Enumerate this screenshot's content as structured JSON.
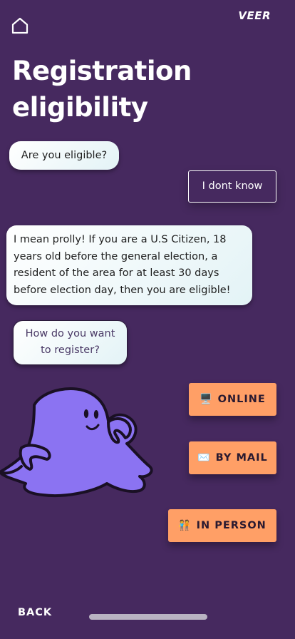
{
  "header": {
    "brand": "VEER",
    "title": "Registration eligibility"
  },
  "chat": {
    "question1": "Are you eligible?",
    "reply": "I dont know",
    "answer": "I mean prolly! If you are a U.S Citizen, 18 years old before the general election, a resident of the area for at least 30 days before election day, then you are eligible!",
    "question2": "How do you want to register?"
  },
  "options": [
    {
      "icon": "🖥️",
      "label": "ONLINE"
    },
    {
      "icon": "✉️",
      "label": "BY MAIL"
    },
    {
      "icon": "🧑‍🤝‍🧑",
      "label": "IN PERSON"
    }
  ],
  "footer": {
    "back_label": "BACK"
  },
  "colors": {
    "background": "#46295f",
    "option_button": "#ff9f66",
    "mascot": "#8b73f2"
  }
}
